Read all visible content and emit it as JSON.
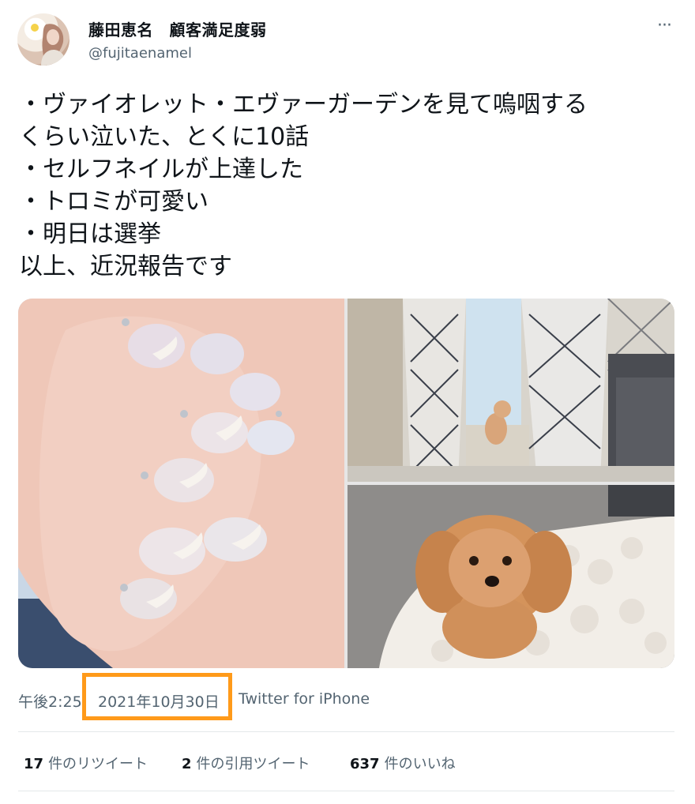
{
  "tweet": {
    "author_name": "藤田恵名　顧客満足度弱",
    "author_handle": "@fujitaenamel",
    "more_icon": "more-icon",
    "text": "・ヴァイオレット・エヴァーガーデンを見て嗚咽する\nくらい泣いた、とくに10話\n・セルフネイルが上達した\n・トロミが可愛い\n・明日は選挙\n以上、近況報告です",
    "time": "午後2:25",
    "date": "2021年10月30日",
    "source": "Twitter for iPhone",
    "stats": {
      "retweets_count": "17",
      "retweets_label": "件のリツイート",
      "quotes_count": "2",
      "quotes_label": "件の引用ツイート",
      "likes_count": "637",
      "likes_label": "件のいいね"
    }
  },
  "highlight_color": "#ff9a1a"
}
